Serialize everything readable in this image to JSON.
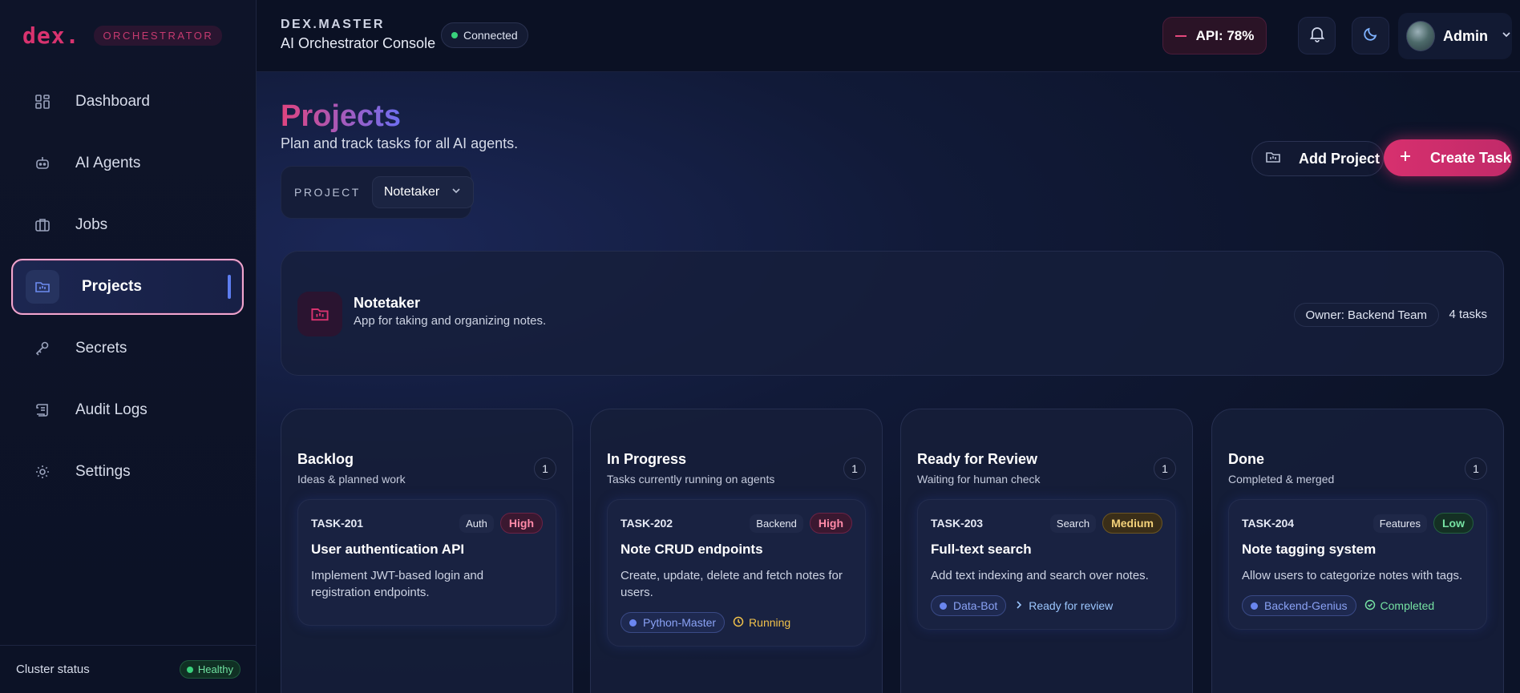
{
  "brand": {
    "logo": "dex.",
    "tag": "ORCHESTRATOR"
  },
  "sidebar": {
    "items": [
      {
        "label": "Dashboard",
        "icon": "dashboard-icon"
      },
      {
        "label": "AI Agents",
        "icon": "robot-icon"
      },
      {
        "label": "Jobs",
        "icon": "briefcase-icon"
      },
      {
        "label": "Projects",
        "icon": "folder-icon",
        "active": true
      },
      {
        "label": "Secrets",
        "icon": "key-icon"
      },
      {
        "label": "Audit Logs",
        "icon": "scroll-icon"
      },
      {
        "label": "Settings",
        "icon": "gear-icon"
      }
    ],
    "cluster_label": "Cluster status",
    "cluster_status": "Healthy"
  },
  "topbar": {
    "eyebrow": "DEX.MASTER",
    "title": "AI Orchestrator Console",
    "connection": "Connected",
    "api": "API: 78%",
    "user": "Admin"
  },
  "page": {
    "title": "Projects",
    "subtitle": "Plan and track tasks for all AI agents.",
    "project_label": "PROJECT",
    "project_value": "Notetaker",
    "add_project": "Add Project",
    "create_task": "Create Task"
  },
  "project": {
    "name": "Notetaker",
    "description": "App for taking and organizing notes.",
    "owner": "Owner: Backend Team",
    "tasks": "4 tasks"
  },
  "columns": [
    {
      "title": "Backlog",
      "subtitle": "Ideas & planned work",
      "count": "1",
      "task": {
        "id": "TASK-201",
        "tag": "Auth",
        "priority": "High",
        "title": "User authentication API",
        "desc": "Implement JWT-based login and registration endpoints.",
        "agent": "",
        "status": ""
      }
    },
    {
      "title": "In Progress",
      "subtitle": "Tasks currently running on agents",
      "count": "1",
      "task": {
        "id": "TASK-202",
        "tag": "Backend",
        "priority": "High",
        "title": "Note CRUD endpoints",
        "desc": "Create, update, delete and fetch notes for users.",
        "agent": "Python-Master",
        "status": "Running"
      }
    },
    {
      "title": "Ready for Review",
      "subtitle": "Waiting for human check",
      "count": "1",
      "task": {
        "id": "TASK-203",
        "tag": "Search",
        "priority": "Medium",
        "title": "Full-text search",
        "desc": "Add text indexing and search over notes.",
        "agent": "Data-Bot",
        "status": "Ready for review"
      }
    },
    {
      "title": "Done",
      "subtitle": "Completed & merged",
      "count": "1",
      "task": {
        "id": "TASK-204",
        "tag": "Features",
        "priority": "Low",
        "title": "Note tagging system",
        "desc": "Allow users to categorize notes with tags.",
        "agent": "Backend-Genius",
        "status": "Completed"
      }
    }
  ],
  "colors": {
    "accent": "#d7306e",
    "primary": "#5d7df0",
    "healthy": "#39d17c"
  }
}
